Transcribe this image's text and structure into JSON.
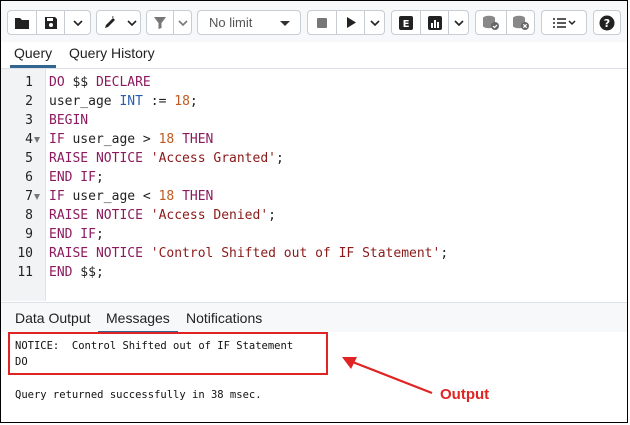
{
  "toolbar": {
    "limit_value": "No limit",
    "icons": [
      "folder-icon",
      "save-icon",
      "chevron-down-icon",
      "pencil-icon",
      "filter-icon",
      "stop-icon",
      "play-icon",
      "explain-icon",
      "chart-icon",
      "commit-icon",
      "rollback-icon",
      "macros-icon",
      "help-icon"
    ],
    "explain_letter": "E",
    "help_glyph": "?"
  },
  "tabs": [
    {
      "label": "Query",
      "active": true
    },
    {
      "label": "Query History",
      "active": false
    }
  ],
  "editor": {
    "lines": [
      {
        "num": "1",
        "fold": false
      },
      {
        "num": "2",
        "fold": false
      },
      {
        "num": "3",
        "fold": false
      },
      {
        "num": "4",
        "fold": true
      },
      {
        "num": "5",
        "fold": false
      },
      {
        "num": "6",
        "fold": false
      },
      {
        "num": "7",
        "fold": true
      },
      {
        "num": "8",
        "fold": false
      },
      {
        "num": "9",
        "fold": false
      },
      {
        "num": "10",
        "fold": false
      },
      {
        "num": "11",
        "fold": false
      }
    ],
    "tokens": {
      "l1a": "DO",
      "l1b": " $$ ",
      "l1c": "DECLARE",
      "l2a": "user_age ",
      "l2b": "INT",
      "l2c": " := ",
      "l2d": "18",
      "l2e": ";",
      "l3a": "BEGIN",
      "l4a": "IF",
      "l4b": " user_age > ",
      "l4c": "18",
      "l4d": " ",
      "l4e": "THEN",
      "l5a": "RAISE NOTICE",
      "l5b": " ",
      "l5c": "'Access Granted'",
      "l5d": ";",
      "l6a": "END IF",
      "l6b": ";",
      "l7a": "IF",
      "l7b": " user_age < ",
      "l7c": "18",
      "l7d": " ",
      "l7e": "THEN",
      "l8a": "RAISE NOTICE",
      "l8b": " ",
      "l8c": "'Access Denied'",
      "l8d": ";",
      "l9a": "END IF",
      "l9b": ";",
      "l10a": "RAISE NOTICE",
      "l10b": " ",
      "l10c": "'Control Shifted out of IF Statement'",
      "l10d": ";",
      "l11a": "END",
      "l11b": " $$;"
    }
  },
  "bottom_tabs": [
    {
      "label": "Data Output",
      "active": false
    },
    {
      "label": "Messages",
      "active": true
    },
    {
      "label": "Notifications",
      "active": false
    }
  ],
  "messages": {
    "notice": "NOTICE:  Control Shifted out of IF Statement",
    "command": "DO",
    "result": "Query returned successfully in 38 msec."
  },
  "annotation": {
    "label": "Output",
    "color": "#e02424"
  },
  "colors": {
    "keyword": "#8b1a5e",
    "type": "#2a5db0",
    "number": "#c05a1f",
    "string": "#8b1a1a",
    "accent": "#326690"
  }
}
